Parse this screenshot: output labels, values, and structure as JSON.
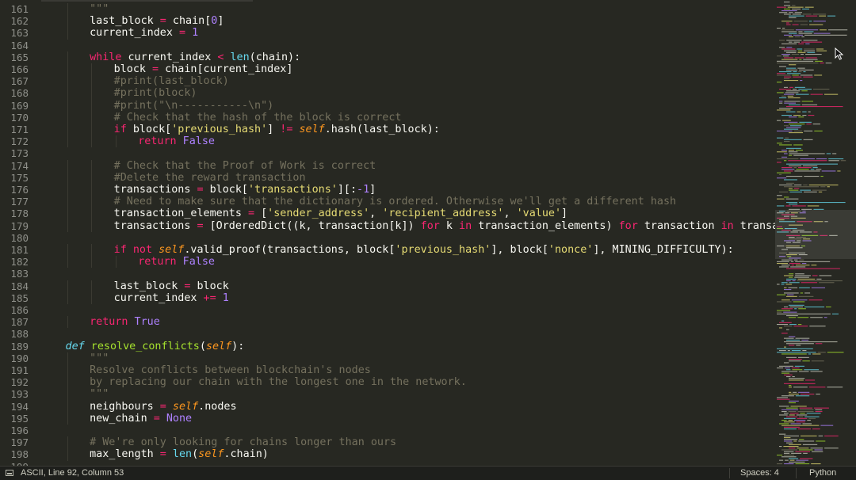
{
  "editor": {
    "lines": [
      {
        "n": "161",
        "indent": 8,
        "t": [
          [
            "\"\"\"",
            "#75715e"
          ]
        ]
      },
      {
        "n": "162",
        "indent": 8,
        "t": [
          [
            "last_block ",
            "#f8f8f2"
          ],
          [
            "=",
            "#f92672"
          ],
          [
            " chain[",
            "#f8f8f2"
          ],
          [
            "0",
            "#ae81ff"
          ],
          [
            "]",
            "#f8f8f2"
          ]
        ]
      },
      {
        "n": "163",
        "indent": 8,
        "t": [
          [
            "current_index ",
            "#f8f8f2"
          ],
          [
            "=",
            "#f92672"
          ],
          [
            " ",
            "#f8f8f2"
          ],
          [
            "1",
            "#ae81ff"
          ]
        ]
      },
      {
        "n": "164",
        "indent": 0,
        "t": []
      },
      {
        "n": "165",
        "indent": 8,
        "t": [
          [
            "while",
            "#f92672"
          ],
          [
            " current_index ",
            "#f8f8f2"
          ],
          [
            "<",
            "#f92672"
          ],
          [
            " ",
            "#f8f8f2"
          ],
          [
            "len",
            "#66d9ef"
          ],
          [
            "(chain):",
            "#f8f8f2"
          ]
        ]
      },
      {
        "n": "166",
        "indent": 12,
        "t": [
          [
            "block ",
            "#f8f8f2"
          ],
          [
            "=",
            "#f92672"
          ],
          [
            " chain[current_index]",
            "#f8f8f2"
          ]
        ]
      },
      {
        "n": "167",
        "indent": 12,
        "t": [
          [
            "#print(last_block)",
            "#75715e"
          ]
        ]
      },
      {
        "n": "168",
        "indent": 12,
        "t": [
          [
            "#print(block)",
            "#75715e"
          ]
        ]
      },
      {
        "n": "169",
        "indent": 12,
        "t": [
          [
            "#print(\"\\n-----------\\n\")",
            "#75715e"
          ]
        ]
      },
      {
        "n": "170",
        "indent": 12,
        "t": [
          [
            "# Check that the hash of the block is correct",
            "#75715e"
          ]
        ]
      },
      {
        "n": "171",
        "indent": 12,
        "t": [
          [
            "if",
            "#f92672"
          ],
          [
            " block[",
            "#f8f8f2"
          ],
          [
            "'previous_hash'",
            "#e6db74"
          ],
          [
            "] ",
            "#f8f8f2"
          ],
          [
            "!=",
            "#f92672"
          ],
          [
            " ",
            "#f8f8f2"
          ],
          [
            "self",
            "#fd971f",
            "i"
          ],
          [
            ".hash(last_block):",
            "#f8f8f2"
          ]
        ]
      },
      {
        "n": "172",
        "indent": 16,
        "t": [
          [
            "return",
            "#f92672"
          ],
          [
            " ",
            "#f8f8f2"
          ],
          [
            "False",
            "#ae81ff"
          ]
        ]
      },
      {
        "n": "173",
        "indent": 0,
        "t": []
      },
      {
        "n": "174",
        "indent": 12,
        "t": [
          [
            "# Check that the Proof of Work is correct",
            "#75715e"
          ]
        ]
      },
      {
        "n": "175",
        "indent": 12,
        "t": [
          [
            "#Delete the reward transaction",
            "#75715e"
          ]
        ]
      },
      {
        "n": "176",
        "indent": 12,
        "t": [
          [
            "transactions ",
            "#f8f8f2"
          ],
          [
            "=",
            "#f92672"
          ],
          [
            " block[",
            "#f8f8f2"
          ],
          [
            "'transactions'",
            "#e6db74"
          ],
          [
            "][:",
            "#f8f8f2"
          ],
          [
            "-1",
            "#ae81ff"
          ],
          [
            "]",
            "#f8f8f2"
          ]
        ]
      },
      {
        "n": "177",
        "indent": 12,
        "t": [
          [
            "# Need to make sure that the dictionary is ordered. Otherwise we'll get a different hash",
            "#75715e"
          ]
        ]
      },
      {
        "n": "178",
        "indent": 12,
        "t": [
          [
            "transaction_elements ",
            "#f8f8f2"
          ],
          [
            "=",
            "#f92672"
          ],
          [
            " [",
            "#f8f8f2"
          ],
          [
            "'sender_address'",
            "#e6db74"
          ],
          [
            ", ",
            "#f8f8f2"
          ],
          [
            "'recipient_address'",
            "#e6db74"
          ],
          [
            ", ",
            "#f8f8f2"
          ],
          [
            "'value'",
            "#e6db74"
          ],
          [
            "]",
            "#f8f8f2"
          ]
        ]
      },
      {
        "n": "179",
        "indent": 12,
        "t": [
          [
            "transactions ",
            "#f8f8f2"
          ],
          [
            "=",
            "#f92672"
          ],
          [
            " [OrderedDict((k, transaction[k]) ",
            "#f8f8f2"
          ],
          [
            "for",
            "#f92672"
          ],
          [
            " k ",
            "#f8f8f2"
          ],
          [
            "in",
            "#f92672"
          ],
          [
            " transaction_elements) ",
            "#f8f8f2"
          ],
          [
            "for",
            "#f92672"
          ],
          [
            " transaction ",
            "#f8f8f2"
          ],
          [
            "in",
            "#f92672"
          ],
          [
            " transactions",
            "#f8f8f2"
          ]
        ]
      },
      {
        "n": "180",
        "indent": 0,
        "t": []
      },
      {
        "n": "181",
        "indent": 12,
        "t": [
          [
            "if",
            "#f92672"
          ],
          [
            " ",
            "#f8f8f2"
          ],
          [
            "not",
            "#f92672"
          ],
          [
            " ",
            "#f8f8f2"
          ],
          [
            "self",
            "#fd971f",
            "i"
          ],
          [
            ".valid_proof(transactions, block[",
            "#f8f8f2"
          ],
          [
            "'previous_hash'",
            "#e6db74"
          ],
          [
            "], block[",
            "#f8f8f2"
          ],
          [
            "'nonce'",
            "#e6db74"
          ],
          [
            "], MINING_DIFFICULTY):",
            "#f8f8f2"
          ]
        ]
      },
      {
        "n": "182",
        "indent": 16,
        "t": [
          [
            "return",
            "#f92672"
          ],
          [
            " ",
            "#f8f8f2"
          ],
          [
            "False",
            "#ae81ff"
          ]
        ]
      },
      {
        "n": "183",
        "indent": 0,
        "t": []
      },
      {
        "n": "184",
        "indent": 12,
        "t": [
          [
            "last_block ",
            "#f8f8f2"
          ],
          [
            "=",
            "#f92672"
          ],
          [
            " block",
            "#f8f8f2"
          ]
        ]
      },
      {
        "n": "185",
        "indent": 12,
        "t": [
          [
            "current_index ",
            "#f8f8f2"
          ],
          [
            "+=",
            "#f92672"
          ],
          [
            " ",
            "#f8f8f2"
          ],
          [
            "1",
            "#ae81ff"
          ]
        ]
      },
      {
        "n": "186",
        "indent": 0,
        "t": []
      },
      {
        "n": "187",
        "indent": 8,
        "t": [
          [
            "return",
            "#f92672"
          ],
          [
            " ",
            "#f8f8f2"
          ],
          [
            "True",
            "#ae81ff"
          ]
        ]
      },
      {
        "n": "188",
        "indent": 0,
        "t": []
      },
      {
        "n": "189",
        "indent": 4,
        "t": [
          [
            "def",
            "#66d9ef",
            "i"
          ],
          [
            " ",
            "#f8f8f2"
          ],
          [
            "resolve_conflicts",
            "#a6e22e"
          ],
          [
            "(",
            "#f8f8f2"
          ],
          [
            "self",
            "#fd971f",
            "i"
          ],
          [
            "):",
            "#f8f8f2"
          ]
        ]
      },
      {
        "n": "190",
        "indent": 8,
        "t": [
          [
            "\"\"\"",
            "#75715e"
          ]
        ]
      },
      {
        "n": "191",
        "indent": 8,
        "t": [
          [
            "Resolve conflicts between blockchain's nodes",
            "#75715e"
          ]
        ]
      },
      {
        "n": "192",
        "indent": 8,
        "t": [
          [
            "by replacing our chain with the longest one in the network.",
            "#75715e"
          ]
        ]
      },
      {
        "n": "193",
        "indent": 8,
        "t": [
          [
            "\"\"\"",
            "#75715e"
          ]
        ]
      },
      {
        "n": "194",
        "indent": 8,
        "t": [
          [
            "neighbours ",
            "#f8f8f2"
          ],
          [
            "=",
            "#f92672"
          ],
          [
            " ",
            "#f8f8f2"
          ],
          [
            "self",
            "#fd971f",
            "i"
          ],
          [
            ".nodes",
            "#f8f8f2"
          ]
        ]
      },
      {
        "n": "195",
        "indent": 8,
        "t": [
          [
            "new_chain ",
            "#f8f8f2"
          ],
          [
            "=",
            "#f92672"
          ],
          [
            " ",
            "#f8f8f2"
          ],
          [
            "None",
            "#ae81ff"
          ]
        ]
      },
      {
        "n": "196",
        "indent": 0,
        "t": []
      },
      {
        "n": "197",
        "indent": 8,
        "t": [
          [
            "# We're only looking for chains longer than ours",
            "#75715e"
          ]
        ]
      },
      {
        "n": "198",
        "indent": 8,
        "t": [
          [
            "max_length ",
            "#f8f8f2"
          ],
          [
            "=",
            "#f92672"
          ],
          [
            " ",
            "#f8f8f2"
          ],
          [
            "len",
            "#66d9ef"
          ],
          [
            "(",
            "#f8f8f2"
          ],
          [
            "self",
            "#fd971f",
            "i"
          ],
          [
            ".chain)",
            "#f8f8f2"
          ]
        ]
      },
      {
        "n": "199",
        "indent": 0,
        "t": []
      }
    ]
  },
  "statusbar": {
    "position": "ASCII, Line 92, Column 53",
    "indentation": "Spaces: 4",
    "syntax": "Python"
  },
  "colors": {
    "background": "#272822",
    "line_number": "#8f908a",
    "keyword": "#f92672",
    "string": "#e6db74",
    "number": "#ae81ff",
    "comment": "#75715e",
    "self": "#fd971f",
    "function": "#a6e22e",
    "builtin": "#66d9ef"
  }
}
